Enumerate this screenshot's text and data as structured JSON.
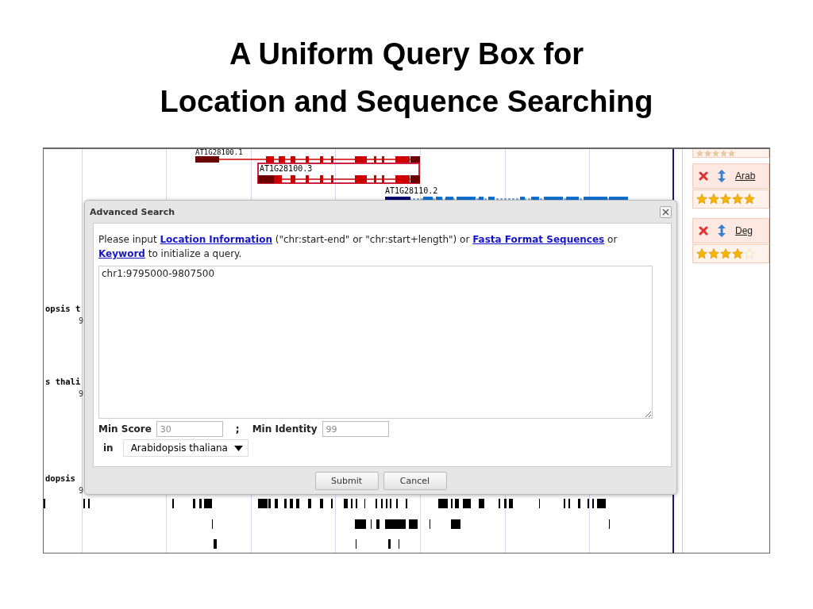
{
  "slide_title": [
    "A Uniform Query Box for",
    "Location and Sequence Searching"
  ],
  "browser": {
    "gene_labels": [
      {
        "text": "AT1G28100.1",
        "kind": "cut"
      },
      {
        "text": "AT1G28100.3",
        "kind": "boxed"
      },
      {
        "text": "AT1G28110.2",
        "kind": "blue"
      }
    ],
    "track_labels": [
      {
        "name": "opsis t",
        "value": "9"
      },
      {
        "name": "s thali",
        "value": "9"
      },
      {
        "name": "dopsis",
        "value": "9"
      }
    ]
  },
  "results": {
    "partial_rating": {
      "stars": 5
    },
    "items": [
      {
        "link": "Arab",
        "stars": 5
      },
      {
        "link": "Deg",
        "stars": 4
      }
    ]
  },
  "dialog": {
    "title": "Advanced Search",
    "instruction": [
      {
        "text": "Please input ",
        "kind": "plain"
      },
      {
        "text": "Location Information",
        "kind": "link"
      },
      {
        "text": " (\"chr:start-end\" or \"chr:start+length\") or ",
        "kind": "plain"
      },
      {
        "text": "Fasta Format Sequences",
        "kind": "link"
      },
      {
        "text": " or ",
        "kind": "plain"
      },
      {
        "text": "Keyword",
        "kind": "link"
      },
      {
        "text": " to initialize a query.",
        "kind": "plain"
      }
    ],
    "query": "chr1:9795000-9807500",
    "min_score": {
      "label": "Min Score",
      "placeholder": "30"
    },
    "separator": ";",
    "min_identity": {
      "label": "Min Identity",
      "placeholder": "99"
    },
    "species": {
      "label": "in",
      "value": "Arabidopsis thaliana"
    },
    "buttons": [
      "Submit",
      "Cancel"
    ]
  }
}
